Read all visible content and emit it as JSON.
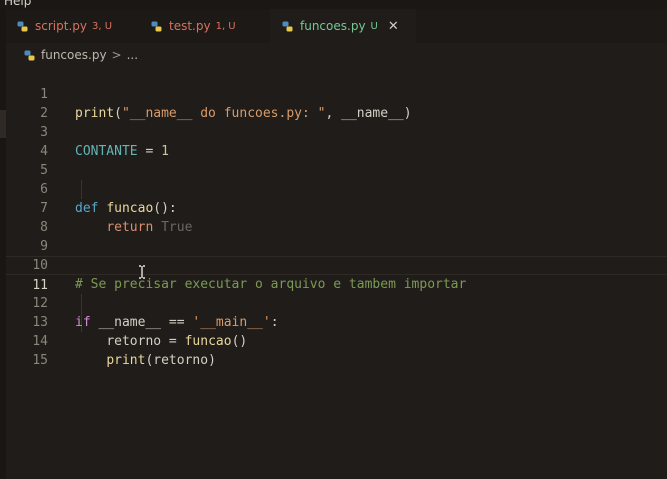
{
  "menubar": {
    "item": "Help"
  },
  "tabs": [
    {
      "label": "script.py",
      "badge": "3, U",
      "active": false,
      "icon": "python-icon"
    },
    {
      "label": "test.py",
      "badge": "1, U",
      "active": false,
      "icon": "python-icon"
    },
    {
      "label": "funcoes.py",
      "badge": "U",
      "active": true,
      "icon": "python-icon",
      "close": "✕"
    }
  ],
  "breadcrumb": {
    "file": "funcoes.py",
    "separator": ">",
    "rest": "..."
  },
  "editor": {
    "current_line": 11,
    "lines": [
      {
        "n": "1"
      },
      {
        "n": "2"
      },
      {
        "n": "3"
      },
      {
        "n": "4"
      },
      {
        "n": "5"
      },
      {
        "n": "6"
      },
      {
        "n": "7"
      },
      {
        "n": "8"
      },
      {
        "n": "9"
      },
      {
        "n": "10"
      },
      {
        "n": "11"
      },
      {
        "n": "12"
      },
      {
        "n": "13"
      },
      {
        "n": "14"
      },
      {
        "n": "15"
      }
    ],
    "code": {
      "l1_fn": "print",
      "l1_open": "(",
      "l1_str": "\"__name__ do funcoes.py: \"",
      "l1_comma": ", ",
      "l1_var": "__name__",
      "l1_close": ")",
      "l3_const": "CONTANTE",
      "l3_eq": " = ",
      "l3_num": "1",
      "l6_kw": "def",
      "l6_fn": "funcao",
      "l6_rest": "():",
      "l7_kw": "return",
      "l7_val": "True",
      "l10_comment": "# Se precisar executar o arquivo e tambem importar",
      "l12_kw": "if",
      "l12_var": "__name__",
      "l12_op": " == ",
      "l12_str": "'__main__'",
      "l12_colon": ":",
      "l13_var": "retorno",
      "l13_eq": " = ",
      "l13_fn": "funcao",
      "l13_paren": "()",
      "l14_fn": "print",
      "l14_open": "(",
      "l14_var": "retorno",
      "l14_close": ")"
    }
  },
  "colors": {
    "background": "#201c19",
    "modified_tab": "#d9715e",
    "untracked_tab": "#74c991",
    "comment": "#7a9a55",
    "keyword": "#5aa8c9"
  }
}
